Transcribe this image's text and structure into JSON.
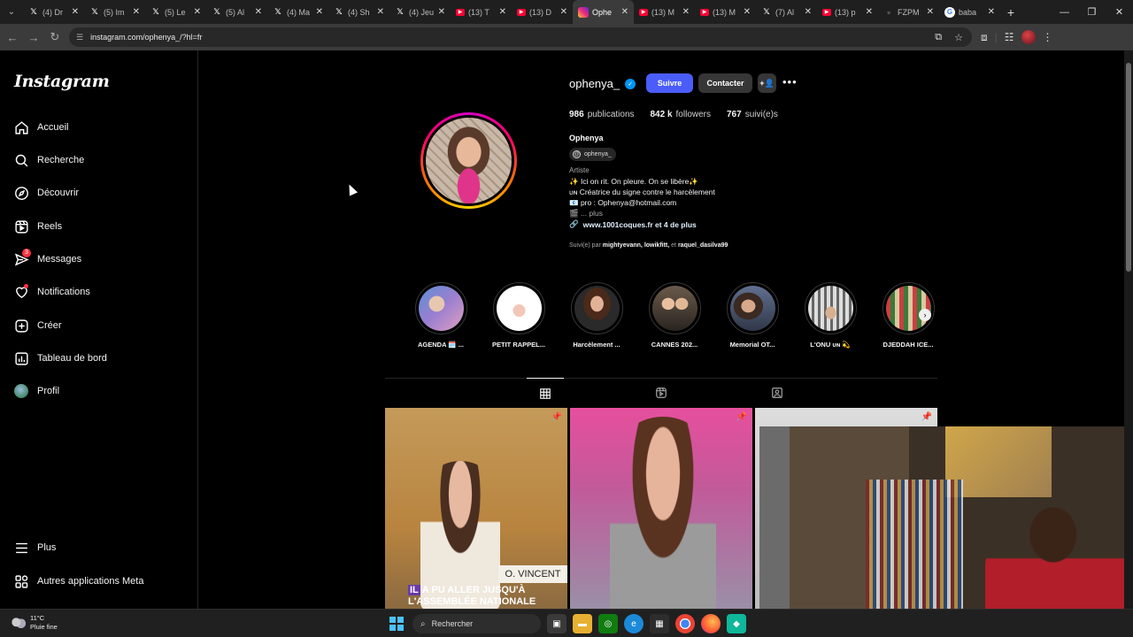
{
  "browser": {
    "tabs": [
      {
        "icon": "x-logo",
        "title": "(4) Dr"
      },
      {
        "icon": "x-logo",
        "title": "(5) Im"
      },
      {
        "icon": "x-logo",
        "title": "(5) Le"
      },
      {
        "icon": "x-logo",
        "title": "(5) Al"
      },
      {
        "icon": "x-logo",
        "title": "(4) Ma"
      },
      {
        "icon": "x-logo",
        "title": "(4) Sh"
      },
      {
        "icon": "x-logo",
        "title": "(4) Jeu"
      },
      {
        "icon": "youtube-icon",
        "title": "(13) T"
      },
      {
        "icon": "youtube-icon",
        "title": "(13) D"
      },
      {
        "icon": "instagram-icon",
        "title": "Ophe",
        "active": true
      },
      {
        "icon": "youtube-icon",
        "title": "(13) M"
      },
      {
        "icon": "youtube-icon",
        "title": "(13) M"
      },
      {
        "icon": "x-logo",
        "title": "(7) Al"
      },
      {
        "icon": "youtube-icon",
        "title": "(13) p"
      },
      {
        "icon": "x-logo",
        "title": "FZPM"
      },
      {
        "icon": "google-icon",
        "title": "baba"
      }
    ],
    "url": "instagram.com/ophenya_/?hl=fr"
  },
  "sidebar": {
    "logo": "Instagram",
    "items": [
      {
        "label": "Accueil",
        "icon": "home-icon"
      },
      {
        "label": "Recherche",
        "icon": "search-icon"
      },
      {
        "label": "Découvrir",
        "icon": "compass-icon"
      },
      {
        "label": "Reels",
        "icon": "reels-icon"
      },
      {
        "label": "Messages",
        "icon": "messenger-icon",
        "badge": "3"
      },
      {
        "label": "Notifications",
        "icon": "heart-icon"
      },
      {
        "label": "Créer",
        "icon": "plus-square-icon"
      },
      {
        "label": "Tableau de bord",
        "icon": "dashboard-icon"
      },
      {
        "label": "Profil",
        "icon": "profile-avatar"
      }
    ],
    "bottom": [
      {
        "label": "Plus",
        "icon": "menu-icon"
      },
      {
        "label": "Autres applications Meta",
        "icon": "meta-apps-icon"
      }
    ]
  },
  "profile": {
    "username": "ophenya_",
    "follow_label": "Suivre",
    "contact_label": "Contacter",
    "stats": {
      "posts_value": "986",
      "posts_label": "publications",
      "followers_value": "842 k",
      "followers_label": "followers",
      "following_value": "767",
      "following_label": "suivi(e)s"
    },
    "full_name": "Ophenya",
    "threads_handle": "ophenya_",
    "category": "Artiste",
    "bio_lines": [
      "✨ Ici on rit. On pleure. On se libère✨",
      "ᴜɴ Créatrice du signe contre le harcèlement",
      "📧 pro : Ophenya@hotmail.com",
      "🎬 ... plus"
    ],
    "link": "www.1001coques.fr et 4 de plus",
    "followed_by_prefix": "Suivi(e) par",
    "followed_by_names": "mightyevann, lowikfitt,",
    "followed_by_and": "et",
    "followed_by_last": "raquel_dasilva99"
  },
  "highlights": [
    {
      "label": "AGENDA 🗓️ ..."
    },
    {
      "label": "PETIT RAPPEL..."
    },
    {
      "label": "Harcèlement ..."
    },
    {
      "label": "CANNES 202..."
    },
    {
      "label": "Memorial OT..."
    },
    {
      "label": "L'ONU ᴜɴ 💫"
    },
    {
      "label": "DJEDDAH ICE..."
    }
  ],
  "posts": [
    {
      "nameplate": "O. VINCENT",
      "caption_tag": "IL",
      "caption_line1": "A PU ALLER JUSQU'À",
      "caption_line2": "L'ASSEMBLÉE NATIONALE"
    },
    {},
    {}
  ],
  "taskbar": {
    "temperature": "11°C",
    "weather": "Pluie fine",
    "search_placeholder": "Rechercher"
  },
  "colors": {
    "follow_button": "#4a5df9",
    "verified": "#0095f6",
    "badge": "#ff3040"
  }
}
